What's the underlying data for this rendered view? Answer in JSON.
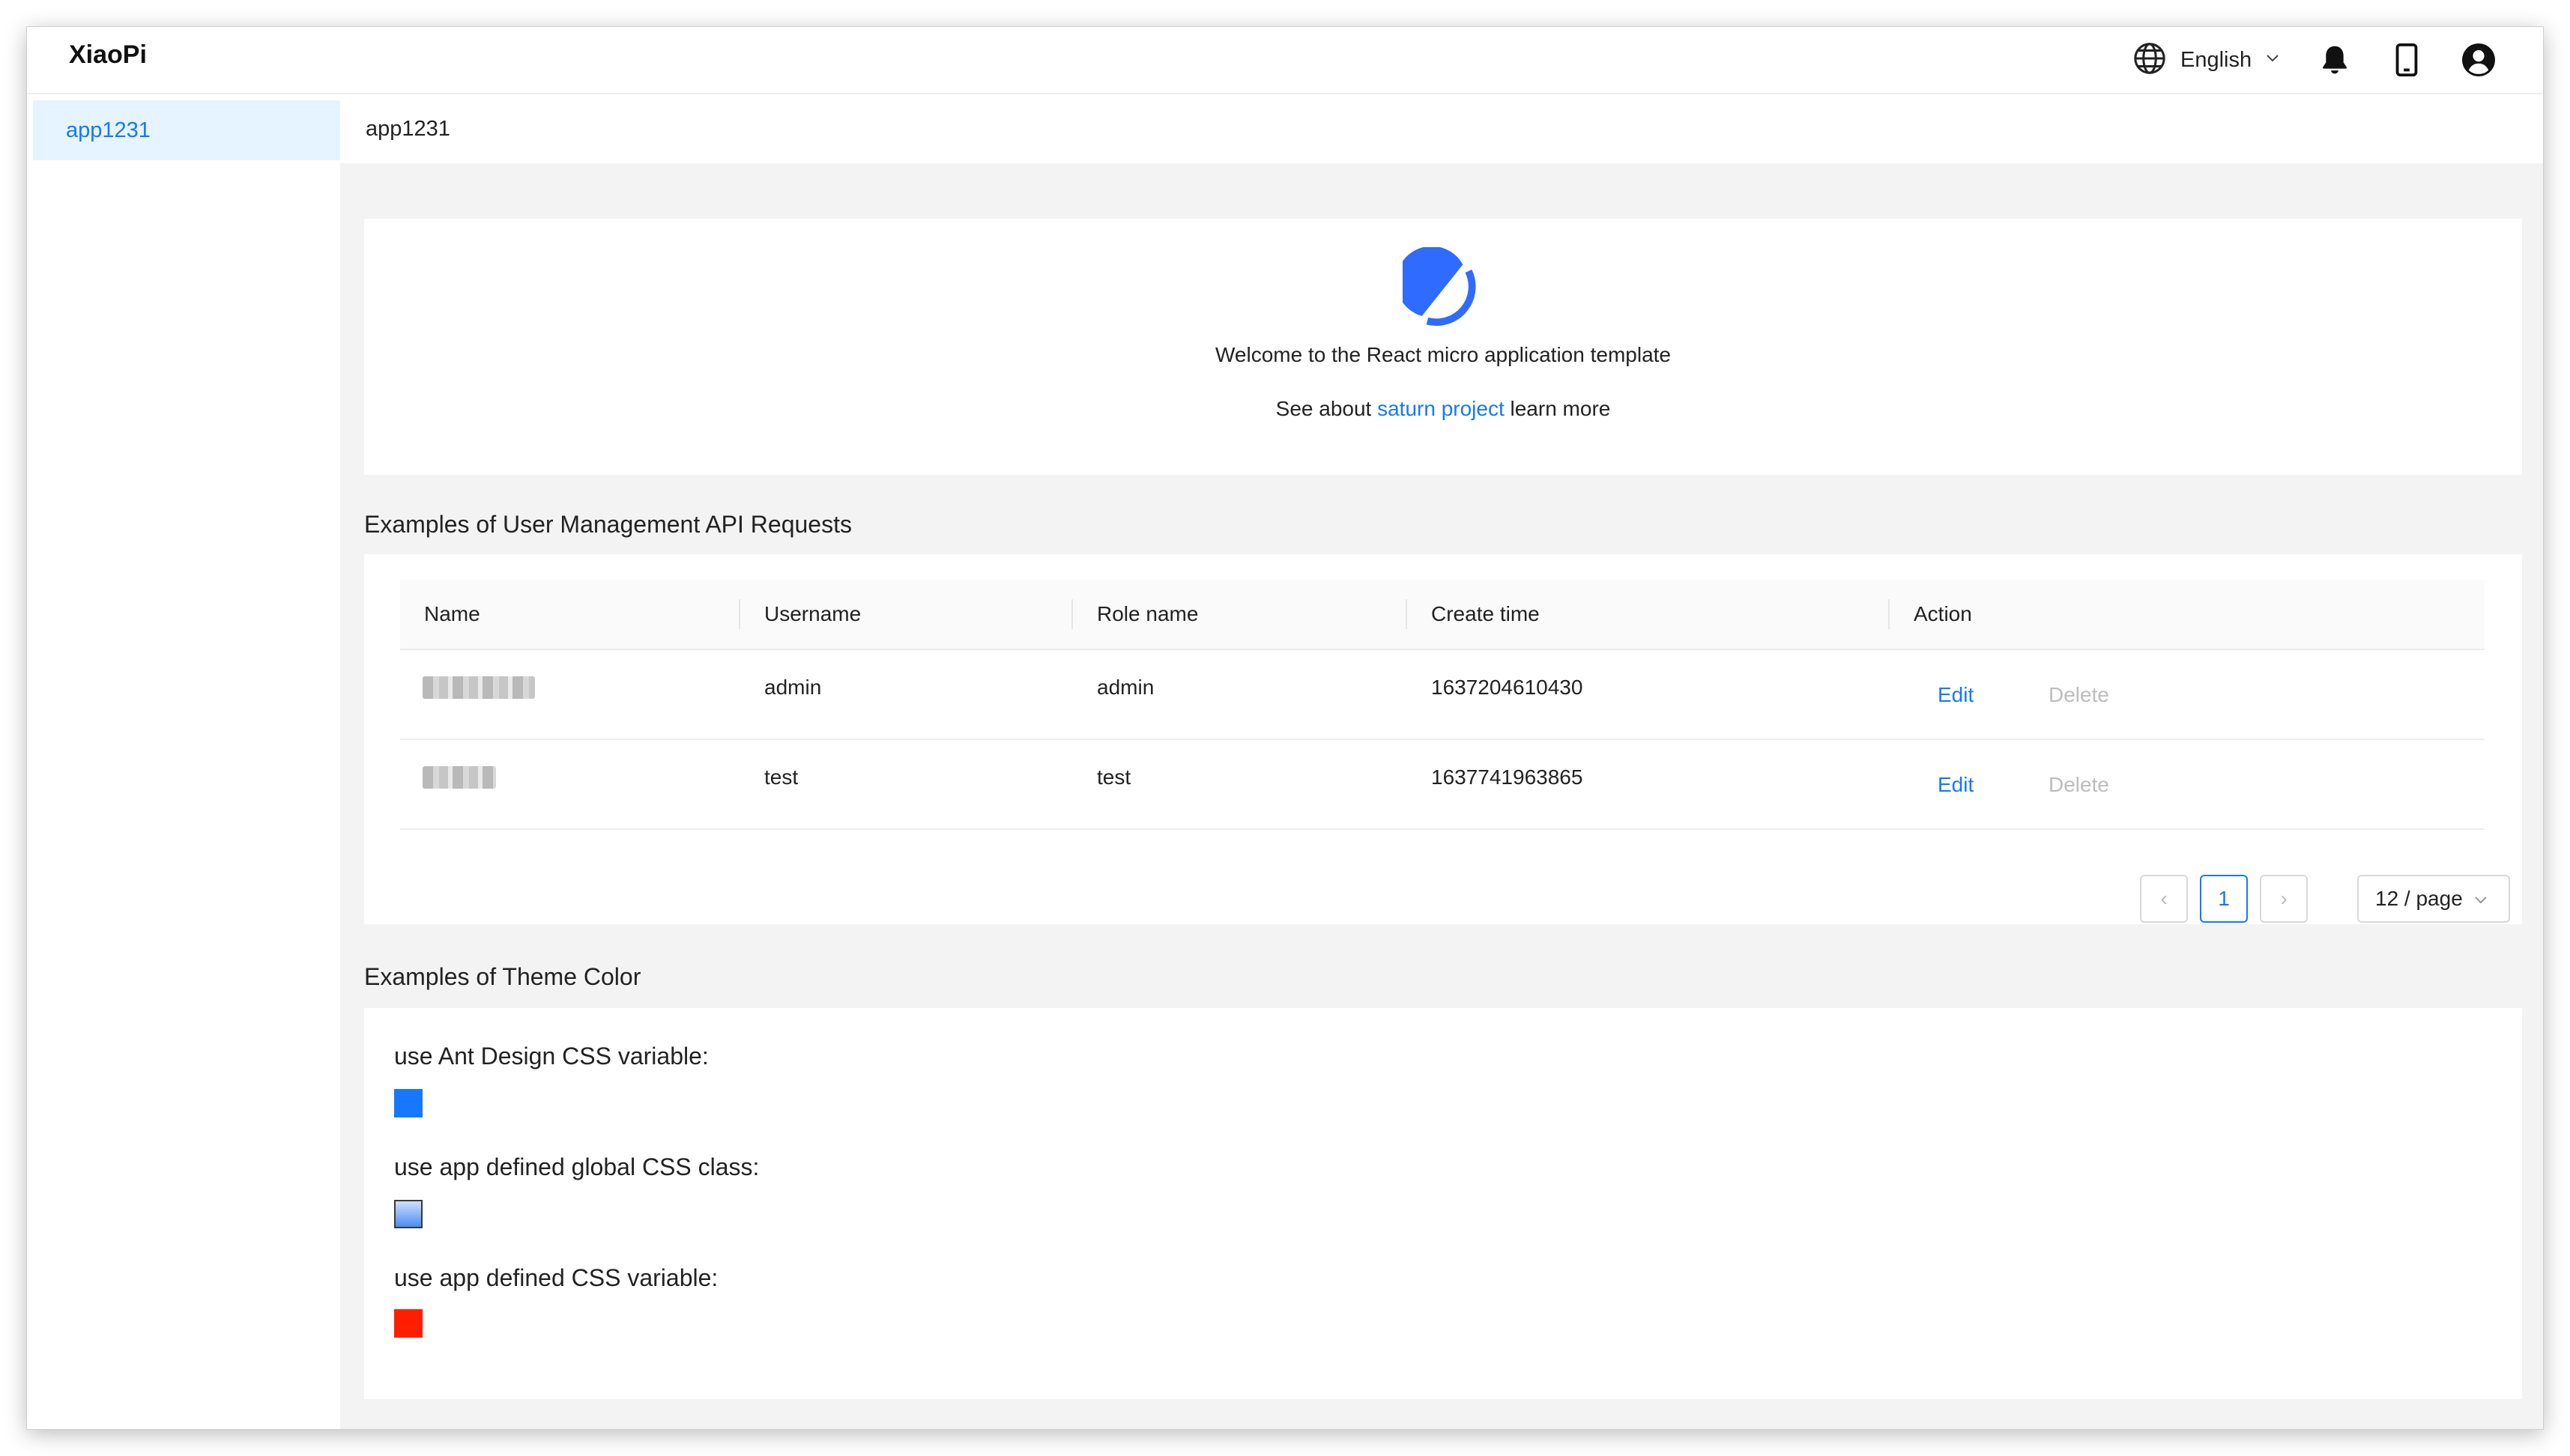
{
  "header": {
    "brand": "XiaoPi",
    "language": "English",
    "icons": [
      "globe-icon",
      "chevron-down-icon",
      "bell-icon",
      "mobile-icon",
      "user-icon"
    ]
  },
  "sidebar": {
    "items": [
      {
        "label": "app1231",
        "active": true
      }
    ],
    "collapse_glyph": "«"
  },
  "breadcrumb": "app1231",
  "welcome": {
    "line1": "Welcome to the React micro application template",
    "line2_prefix": "See about",
    "line2_link": "saturn project",
    "line2_suffix": "learn more"
  },
  "user_section": {
    "title": "Examples of User Management API Requests",
    "columns": [
      "Name",
      "Username",
      "Role name",
      "Create time",
      "Action"
    ],
    "rows": [
      {
        "name": "",
        "username": "admin",
        "role": "admin",
        "create_time": "1637204610430",
        "edit": "Edit",
        "delete": "Delete"
      },
      {
        "name": "",
        "username": "test",
        "role": "test",
        "create_time": "1637741963865",
        "edit": "Edit",
        "delete": "Delete"
      }
    ],
    "pagination": {
      "prev": "‹",
      "current": "1",
      "next": "›",
      "page_size": "12 / page"
    }
  },
  "theme_section": {
    "title": "Examples of Theme Color",
    "items": [
      {
        "label": "use Ant Design CSS variable:",
        "color": "#1677ff"
      },
      {
        "label": "use app defined global CSS class:",
        "color": "gradient"
      },
      {
        "label": "use app defined CSS variable:",
        "color": "#ff1f00"
      }
    ]
  },
  "colors": {
    "primary": "#1677ff",
    "menu_active_bg": "#e6f4ff",
    "danger": "#ff1f00"
  }
}
